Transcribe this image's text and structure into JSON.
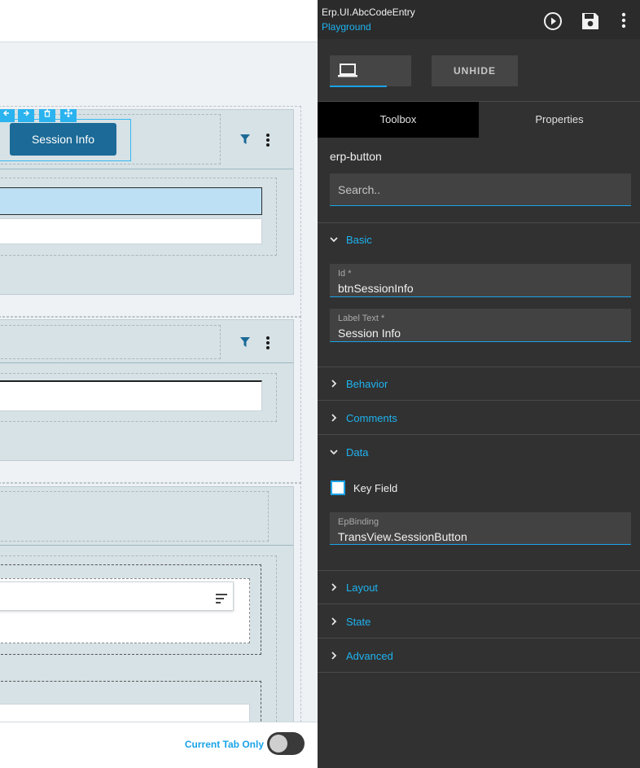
{
  "canvas": {
    "selected_button_label": "Session Info",
    "footer": {
      "current_tab_label": "Current Tab Only",
      "toggle_on": false
    }
  },
  "panel": {
    "header": {
      "title": "Erp.UI.AbcCodeEntry",
      "subtitle": "Playground"
    },
    "toolbar": {
      "unhide_label": "UNHIDE"
    },
    "tabs": [
      {
        "label": "Toolbox",
        "active": true
      },
      {
        "label": "Properties",
        "active": false
      }
    ],
    "component_name": "erp-button",
    "search": {
      "placeholder": "Search.."
    },
    "sections": {
      "basic": "Basic",
      "behavior": "Behavior",
      "comments": "Comments",
      "data": "Data",
      "layout": "Layout",
      "state": "State",
      "advanced": "Advanced"
    },
    "basic": {
      "id_label": "Id *",
      "id_value": "btnSessionInfo",
      "label_text_label": "Label Text *",
      "label_text_value": "Session Info"
    },
    "data": {
      "key_field_label": "Key Field",
      "key_field_checked": false,
      "ep_binding_label": "EpBinding",
      "ep_binding_value": "TransView.SessionButton"
    }
  },
  "colors": {
    "accent": "#1aa3e8",
    "button_blue": "#1b6a97",
    "panel_bg": "#313131"
  },
  "icons": [
    "play-circle-icon",
    "save-icon",
    "more-vert-icon",
    "laptop-icon",
    "filter-icon",
    "chevron-down-icon",
    "chevron-right-icon",
    "sort-icon",
    "arrow-left-icon",
    "arrow-right-icon",
    "trash-icon",
    "move-icon"
  ]
}
